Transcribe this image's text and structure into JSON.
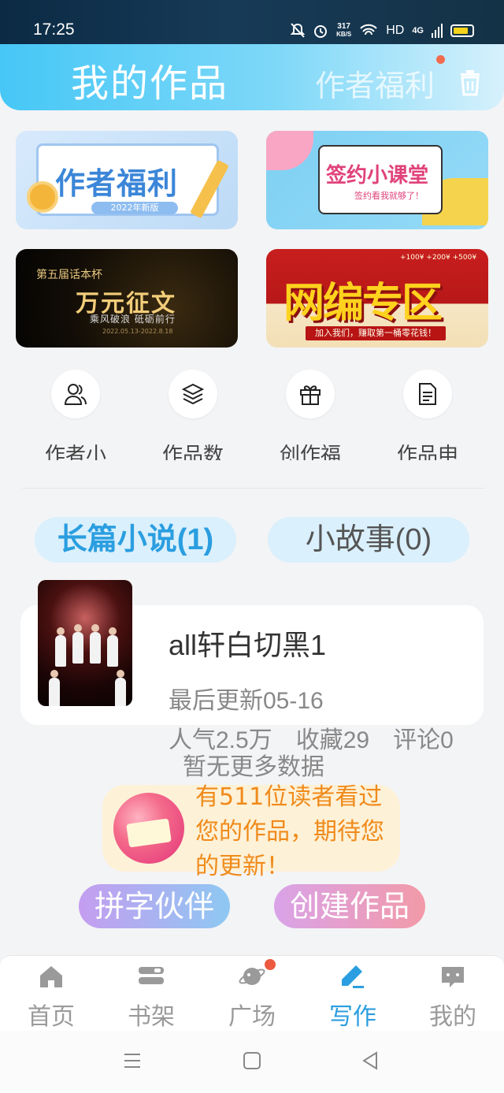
{
  "status_bar": {
    "time": "17:25",
    "net_speed_value": "317",
    "net_speed_unit": "KB/S",
    "hd": "HD",
    "signal": "4G"
  },
  "header": {
    "title": "我的作品",
    "benefits_link": "作者福利",
    "icons": [
      "trash-icon"
    ]
  },
  "banners": [
    {
      "title": "作者福利",
      "subtitle": "2022年新版"
    },
    {
      "title": "签约小课堂",
      "subtitle": "签约看我就够了！"
    },
    {
      "kicker": "第五届话本杯",
      "title": "万元征文",
      "subtitle": "乘风破浪 砥砺前行",
      "date": "2022.05.13-2022.8.18"
    },
    {
      "title": "网编专区",
      "subtitle": "加入我们，赚取第一桶零花钱！",
      "top_text": "+100¥ +200¥ +500¥"
    }
  ],
  "quick_menu": [
    {
      "label": "作者小",
      "icon": "user-group-icon"
    },
    {
      "label": "作品数",
      "icon": "layers-icon"
    },
    {
      "label": "创作福",
      "icon": "gift-icon"
    },
    {
      "label": "作品申",
      "icon": "document-icon"
    }
  ],
  "tabs": [
    {
      "label": "长篇小说(1)",
      "active": true
    },
    {
      "label": "小故事(0)",
      "active": false
    }
  ],
  "work": {
    "title": "all轩白切黑1",
    "updated": "最后更新05-16",
    "popularity": "人气2.5万",
    "favorites": "收藏29",
    "comments": "评论0"
  },
  "no_more": "暂无更多数据",
  "notice": {
    "text": "有511位读者看过您的作品，期待您的更新！"
  },
  "actions": {
    "partner": "拼字伙伴",
    "create": "创建作品"
  },
  "bottom_nav": [
    {
      "label": "首页",
      "icon": "home-icon"
    },
    {
      "label": "书架",
      "icon": "bookshelf-icon"
    },
    {
      "label": "广场",
      "icon": "planet-icon"
    },
    {
      "label": "写作",
      "icon": "pen-icon",
      "active": true
    },
    {
      "label": "我的",
      "icon": "chat-icon"
    }
  ],
  "colors": {
    "accent": "#2a9ee0",
    "header_gradient_start": "#46c7f6",
    "notice_text": "#f08a1a",
    "badge": "#ec5a40"
  }
}
